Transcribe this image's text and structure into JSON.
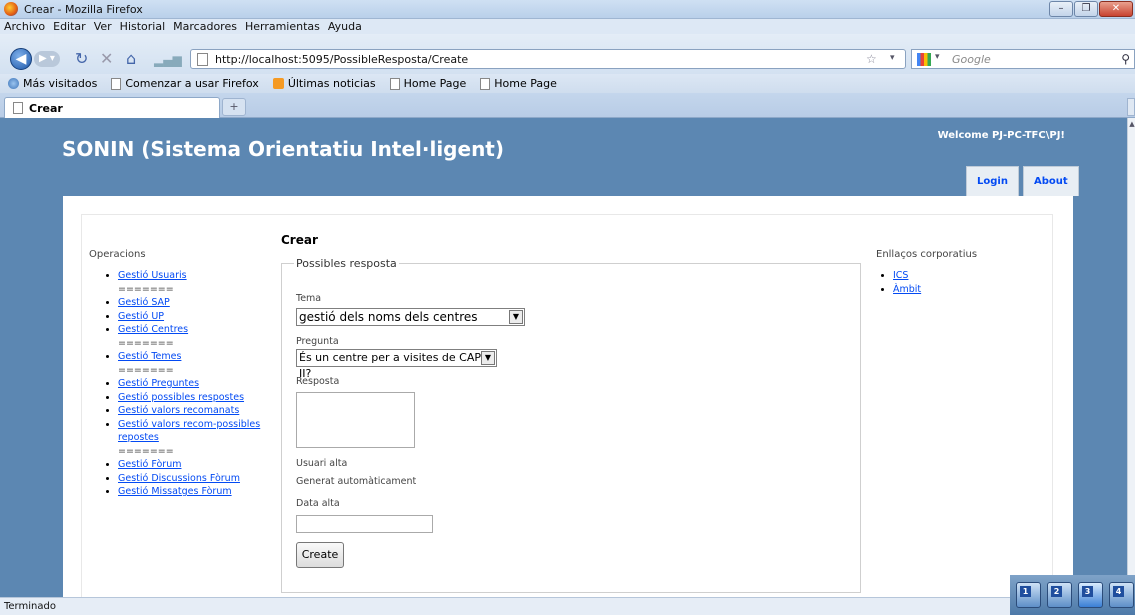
{
  "window": {
    "title": "Crear - Mozilla Firefox"
  },
  "menubar": {
    "items": [
      "Archivo",
      "Editar",
      "Ver",
      "Historial",
      "Marcadores",
      "Herramientas",
      "Ayuda"
    ]
  },
  "navbar": {
    "url": "http://localhost:5095/PossibleResposta/Create",
    "search_placeholder": "Google"
  },
  "bookmarks": {
    "items": [
      "Más visitados",
      "Comenzar a usar Firefox",
      "Últimas noticias",
      "Home Page",
      "Home Page"
    ]
  },
  "tabs": {
    "active_tab": "Crear",
    "new_tab_symbol": "+"
  },
  "site": {
    "title": "SONIN (Sistema Orientatiu Intel·ligent)",
    "welcome": "Welcome PJ-PC-TFC\\PJ!",
    "menu": [
      "Login",
      "About"
    ]
  },
  "left_nav": {
    "heading": "Operacions",
    "items": [
      "Gestió Usuaris",
      "=======",
      "Gestió SAP",
      "Gestió UP",
      "Gestió Centres",
      "=======",
      "Gestió Temes",
      "=======",
      "Gestió Preguntes",
      "Gestió possibles respostes",
      "Gestió valors recomanats",
      "Gestió valors recom-possibles repostes",
      "=======",
      "Gestió Fòrum",
      "Gestió Discussions Fòrum",
      "Gestió Missatges Fòrum"
    ]
  },
  "right_nav": {
    "heading": "Enllaços corporatius",
    "items": [
      "ICS",
      "Àmbit"
    ]
  },
  "form": {
    "page_heading": "Crear",
    "legend": "Possibles resposta",
    "tema_label": "Tema",
    "tema_value": "gestió dels noms dels centres",
    "pregunta_label": "Pregunta",
    "pregunta_value": "És un centre per a visites de CAP II?",
    "resposta_label": "Resposta",
    "resposta_value": "",
    "usuari_label": "Usuari alta",
    "usuari_value": "Generat automàticament",
    "data_label": "Data alta",
    "data_value": "",
    "submit_label": "Create"
  },
  "statusbar": {
    "text": "Terminado"
  },
  "tray": {
    "desktops": [
      "1",
      "2",
      "3",
      "4"
    ]
  }
}
